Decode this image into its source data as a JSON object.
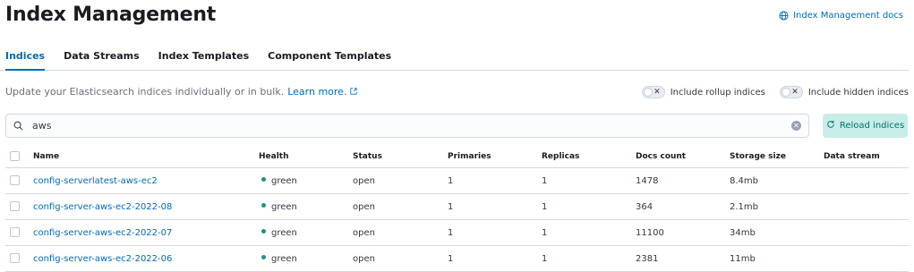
{
  "header": {
    "title": "Index Management",
    "docs_link": "Index Management docs"
  },
  "tabs": [
    {
      "label": "Indices",
      "active": true
    },
    {
      "label": "Data Streams",
      "active": false
    },
    {
      "label": "Index Templates",
      "active": false
    },
    {
      "label": "Component Templates",
      "active": false
    }
  ],
  "description": {
    "text": "Update your Elasticsearch indices individually or in bulk.",
    "learn_more": "Learn more."
  },
  "toggles": {
    "rollup_label": "Include rollup indices",
    "hidden_label": "Include hidden indices"
  },
  "search": {
    "value": "aws"
  },
  "reload_button": "Reload indices",
  "table": {
    "headers": [
      "Name",
      "Health",
      "Status",
      "Primaries",
      "Replicas",
      "Docs count",
      "Storage size",
      "Data stream"
    ],
    "rows": [
      {
        "name": "config-serverlatest-aws-ec2",
        "health": "green",
        "status": "open",
        "primaries": "1",
        "replicas": "1",
        "docs": "1478",
        "size": "8.4mb",
        "stream": ""
      },
      {
        "name": "config-server-aws-ec2-2022-08",
        "health": "green",
        "status": "open",
        "primaries": "1",
        "replicas": "1",
        "docs": "364",
        "size": "2.1mb",
        "stream": ""
      },
      {
        "name": "config-server-aws-ec2-2022-07",
        "health": "green",
        "status": "open",
        "primaries": "1",
        "replicas": "1",
        "docs": "11100",
        "size": "34mb",
        "stream": ""
      },
      {
        "name": "config-server-aws-ec2-2022-06",
        "health": "green",
        "status": "open",
        "primaries": "1",
        "replicas": "1",
        "docs": "2381",
        "size": "11mb",
        "stream": ""
      }
    ]
  },
  "colors": {
    "accent": "#006bb8",
    "health_green": "#209280",
    "reload_bg": "#c7ede9"
  }
}
